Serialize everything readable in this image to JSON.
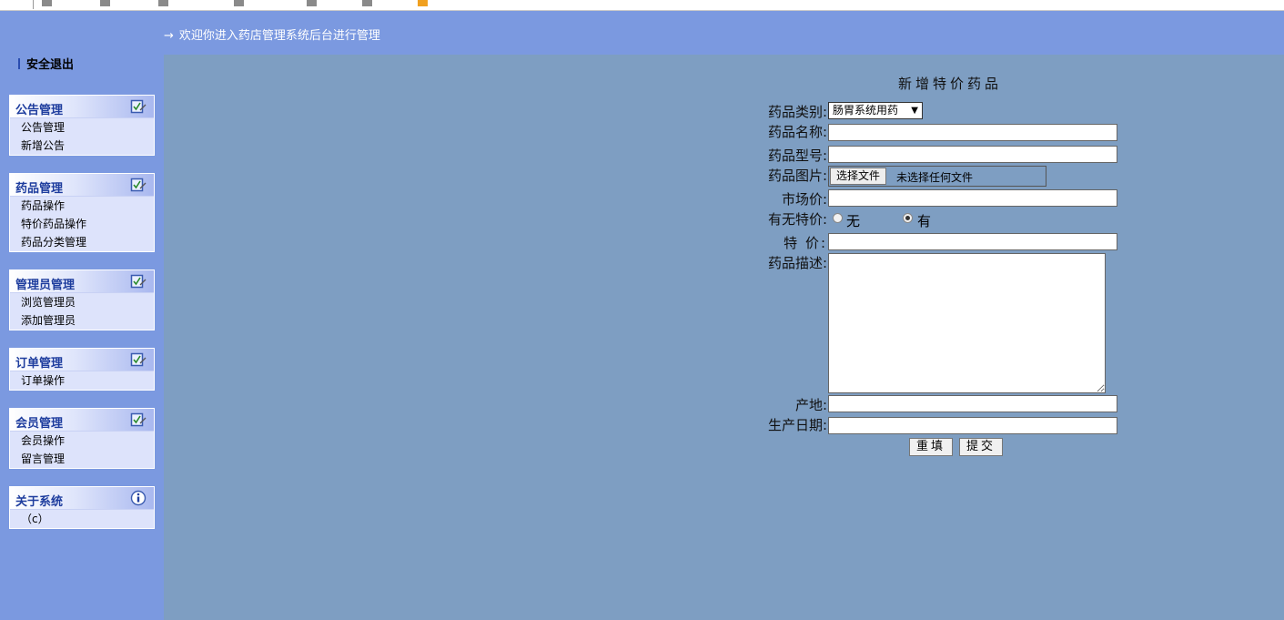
{
  "header": {
    "welcome_arrow": "→",
    "welcome_text": "欢迎你进入药店管理系统后台进行管理",
    "logout_label": "安全退出"
  },
  "sidebar": {
    "panels": [
      {
        "title": "公告管理",
        "icon": "edit-check-icon",
        "items": [
          "公告管理",
          "新增公告"
        ]
      },
      {
        "title": "药品管理",
        "icon": "edit-check-icon",
        "items": [
          "药品操作",
          "特价药品操作",
          "药品分类管理"
        ]
      },
      {
        "title": "管理员管理",
        "icon": "edit-check-icon",
        "items": [
          "浏览管理员",
          "添加管理员"
        ]
      },
      {
        "title": "订单管理",
        "icon": "edit-check-icon",
        "items": [
          "订单操作"
        ]
      },
      {
        "title": "会员管理",
        "icon": "edit-check-icon",
        "items": [
          "会员操作",
          "留言管理"
        ]
      },
      {
        "title": "关于系统",
        "icon": "info-icon",
        "items": [
          "（c）"
        ]
      }
    ]
  },
  "form": {
    "title": "新增特价药品",
    "category_label": "药品类别:",
    "category_value": "肠胃系统用药",
    "name_label": "药品名称:",
    "name_value": "",
    "model_label": "药品型号:",
    "model_value": "",
    "image_label": "药品图片:",
    "file_button": "选择文件",
    "file_status": "未选择任何文件",
    "market_price_label": "市场价:",
    "market_price_value": "",
    "special_label": "有无特价:",
    "special_options": [
      "无",
      "有"
    ],
    "special_selected": "有",
    "special_price_label": "特 价:",
    "special_price_value": "",
    "desc_label": "药品描述:",
    "desc_value": "",
    "origin_label": "产地:",
    "origin_value": "",
    "date_label": "生产日期:",
    "date_value": "",
    "reset_button": "重填",
    "submit_button": "提交"
  },
  "colors": {
    "page_bg": "#7b99e0",
    "main_bg": "#7e9ec2",
    "panel_bg": "#dde3fb",
    "panel_title": "#1e3d9e"
  }
}
